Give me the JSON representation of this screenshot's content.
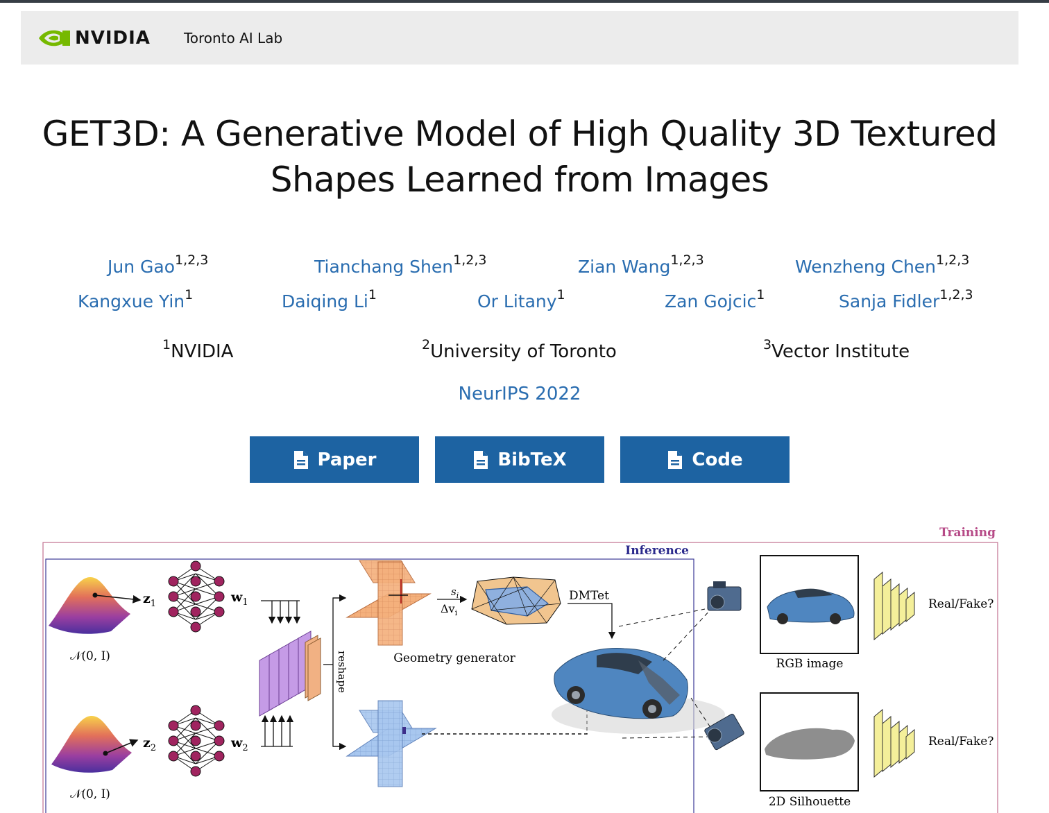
{
  "navbar": {
    "brand": "NVIDIA",
    "lab": "Toronto AI Lab"
  },
  "title": {
    "line1": "GET3D: A Generative Model of High Quality 3D Textured",
    "line2": "Shapes Learned from Images"
  },
  "authors": [
    {
      "name": "Jun Gao",
      "sup": "1,2,3"
    },
    {
      "name": "Tianchang Shen",
      "sup": "1,2,3"
    },
    {
      "name": "Zian Wang",
      "sup": "1,2,3"
    },
    {
      "name": "Wenzheng Chen",
      "sup": "1,2,3"
    },
    {
      "name": "Kangxue Yin",
      "sup": "1"
    },
    {
      "name": "Daiqing Li",
      "sup": "1"
    },
    {
      "name": "Or Litany",
      "sup": "1"
    },
    {
      "name": "Zan Gojcic",
      "sup": "1"
    },
    {
      "name": "Sanja Fidler",
      "sup": "1,2,3"
    }
  ],
  "affiliations": [
    {
      "sup": "1",
      "name": "NVIDIA"
    },
    {
      "sup": "2",
      "name": "University of Toronto"
    },
    {
      "sup": "3",
      "name": "Vector Institute"
    }
  ],
  "venue": "NeurIPS 2022",
  "buttons": [
    {
      "label": "Paper",
      "icon": "file-icon"
    },
    {
      "label": "BibTeX",
      "icon": "file-icon"
    },
    {
      "label": "Code",
      "icon": "file-icon"
    }
  ],
  "figure": {
    "training": "Training",
    "inference": "Inference",
    "z1": "z",
    "z1_sub": "1",
    "z2": "z",
    "z2_sub": "2",
    "w1": "w",
    "w1_sub": "1",
    "w2": "w",
    "w2_sub": "2",
    "normal1": "𝒩(0, I)",
    "normal2": "𝒩(0, I)",
    "reshape": "reshape",
    "geometry_generator": "Geometry generator",
    "si": "s",
    "si_sub": "i",
    "dv": "Δv",
    "dv_sub": "i",
    "dmtet": "DMTet",
    "rgb_image": "RGB image",
    "silhouette": "2D Silhouette",
    "real_fake_1": "Real/Fake?",
    "real_fake_2": "Real/Fake?",
    "colors": {
      "training": "#b64a87",
      "inference": "#2b2a8c"
    }
  }
}
